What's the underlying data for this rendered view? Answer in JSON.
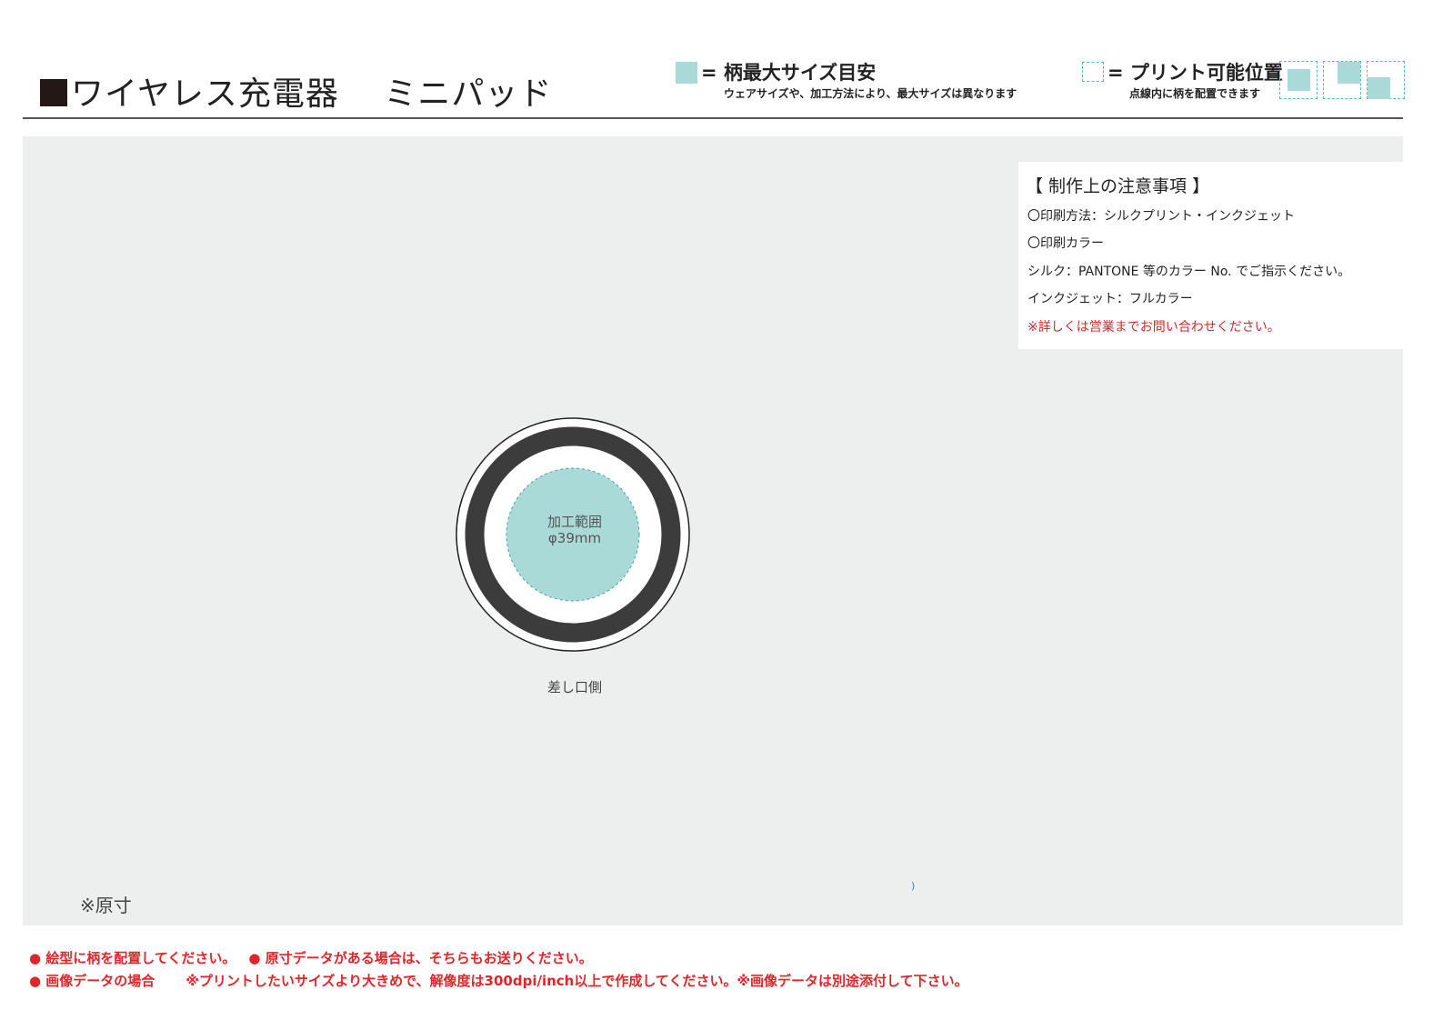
{
  "header": {
    "title": "ワイヤレス充電器　 ミニパッド",
    "legend_max": {
      "label": "= 柄最大サイズ目安",
      "note": "ウェアサイズや、加工方法により、最大サイズは異なります"
    },
    "legend_area": {
      "label": "= プリント可能位置",
      "note": "点線内に柄を配置できます"
    }
  },
  "notes": {
    "title": "【 制作上の注意事項 】",
    "lines": [
      "〇印刷方法：シルクプリント・インクジェット",
      "〇印刷カラー",
      "シルク：PANTONE 等のカラー No. でご指示ください。",
      "インクジェット：フルカラー"
    ],
    "warning": "※詳しくは営業までお問い合わせください。"
  },
  "diagram": {
    "area_label": "加工範囲",
    "area_size": "φ39mm",
    "side_label": "差し口側",
    "stray_mark": ")",
    "actual_size": "※原寸"
  },
  "footer": {
    "line1_a": "● 絵型に柄を配置してください。",
    "line1_b": "● 原寸データがある場合は、そちらもお送りください。",
    "line2_a": "● 画像データの場合",
    "line2_b": "※プリントしたいサイズより大きめで、解像度は300dpi/inch以上で作成してください。※画像データは別途添付して下さい。"
  },
  "colors": {
    "print_area": "#a9dad8",
    "dashed_outline": "#5ab5bd",
    "canvas_bg": "#edeeee",
    "ring": "#3c3c3c",
    "warning_red": "#e0262a"
  }
}
